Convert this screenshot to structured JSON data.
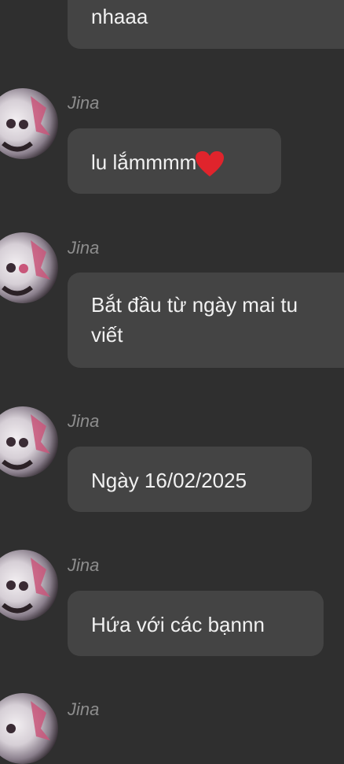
{
  "messages": [
    {
      "sender": "",
      "text": "nhaaa"
    },
    {
      "sender": "Jina",
      "text": "lu lắmmmm",
      "emoji": "heart-icon"
    },
    {
      "sender": "Jina",
      "line1": "Bắt đầu từ ngày mai tu",
      "line2": "viết"
    },
    {
      "sender": "Jina",
      "text": "Ngày 16/02/2025"
    },
    {
      "sender": "Jina",
      "text": "Hứa với các bạnnn"
    },
    {
      "sender": "Jina"
    }
  ],
  "colors": {
    "background": "#2f2f2f",
    "bubble": "#444444",
    "text": "#f1f1f1",
    "name": "#8d8d8d",
    "heart": "#e0242c"
  }
}
